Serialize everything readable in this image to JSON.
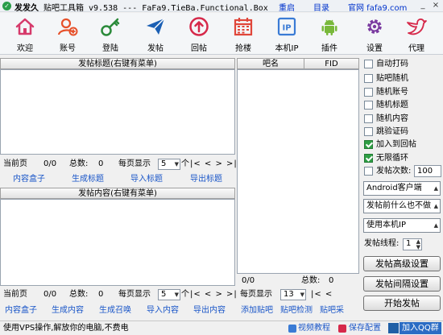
{
  "title": {
    "name": "发发久",
    "text": "贴吧工具箱 v9.538 --- FaFa9.TieBa.Functional.Box",
    "links": [
      "重启",
      "目录",
      "官网 fafa9.com"
    ],
    "controls": [
      "_",
      "×"
    ]
  },
  "toolbar": [
    {
      "label": "欢迎",
      "icon": "home-icon",
      "color": "#d63a6b"
    },
    {
      "label": "账号",
      "icon": "user-add-icon",
      "color": "#e6502a"
    },
    {
      "label": "登陆",
      "icon": "key-icon",
      "color": "#2a8a3a"
    },
    {
      "label": "发帖",
      "icon": "send-icon",
      "color": "#1a5fb4"
    },
    {
      "label": "回帖",
      "icon": "reply-icon",
      "color": "#d6294a"
    },
    {
      "label": "抢楼",
      "icon": "calendar-icon",
      "color": "#e0463a"
    },
    {
      "label": "本机IP",
      "icon": "ip-icon",
      "color": "#3a7bd5"
    },
    {
      "label": "插件",
      "icon": "android-icon",
      "color": "#78b83a"
    },
    {
      "label": "设置",
      "icon": "gear-icon",
      "color": "#7a3aa0"
    },
    {
      "label": "代理",
      "icon": "bird-icon",
      "color": "#d6294a"
    }
  ],
  "topPanel": {
    "header": "发帖标题(右键有菜单)"
  },
  "tablePanel": {
    "columns": [
      "吧名",
      "FID"
    ]
  },
  "pager1": {
    "current_label": "当前页",
    "current": "0/0",
    "total_label": "总数:",
    "total": "0",
    "perpage_label": "每页显示",
    "perpage": "5",
    "unit": "个",
    "nav": "|< < > >|"
  },
  "titleLinks": [
    "内容盒子",
    "生成标题",
    "导入标题",
    "导出标题"
  ],
  "contentPanel": {
    "header": "发帖内容(右键有菜单)"
  },
  "pager2": {
    "current_label": "当前页",
    "current": "0/0",
    "total_label": "总数:",
    "total": "0",
    "perpage_label": "每页显示",
    "perpage": "5",
    "unit": "个",
    "nav": "|< < > >|"
  },
  "contentLinks": [
    "内容盒子",
    "生成内容",
    "生成召唤",
    "导入内容",
    "导出内容"
  ],
  "pager3": {
    "current": "0/0",
    "total_label": "总数:",
    "total": "0",
    "perpage_label": "每页显示",
    "perpage": "13",
    "nav": "|< <"
  },
  "tableLinks": [
    "添加贴吧",
    "贴吧检测",
    "贴吧采"
  ],
  "options": [
    {
      "label": "自动打码",
      "checked": false
    },
    {
      "label": "贴吧随机",
      "checked": false
    },
    {
      "label": "随机账号",
      "checked": false
    },
    {
      "label": "随机标题",
      "checked": false
    },
    {
      "label": "随机内容",
      "checked": false
    },
    {
      "label": "跳验证码",
      "checked": false
    },
    {
      "label": "加入到回帖",
      "checked": true
    },
    {
      "label": "无限循环",
      "checked": true
    }
  ],
  "sendCount": {
    "label": "发帖次数:",
    "value": "100",
    "checked": false
  },
  "combos": [
    "Android客户端",
    "发帖前什么也不做",
    "使用本机IP"
  ],
  "threads": {
    "label": "发帖线程:",
    "value": "1"
  },
  "buttons": [
    "发帖高级设置",
    "发帖间隔设置",
    "开始发帖"
  ],
  "status": {
    "text": "使用VPS操作,解放你的电脑,不费电",
    "video": "视频教程",
    "save": "保存配置",
    "qq": "加入QQ群"
  }
}
